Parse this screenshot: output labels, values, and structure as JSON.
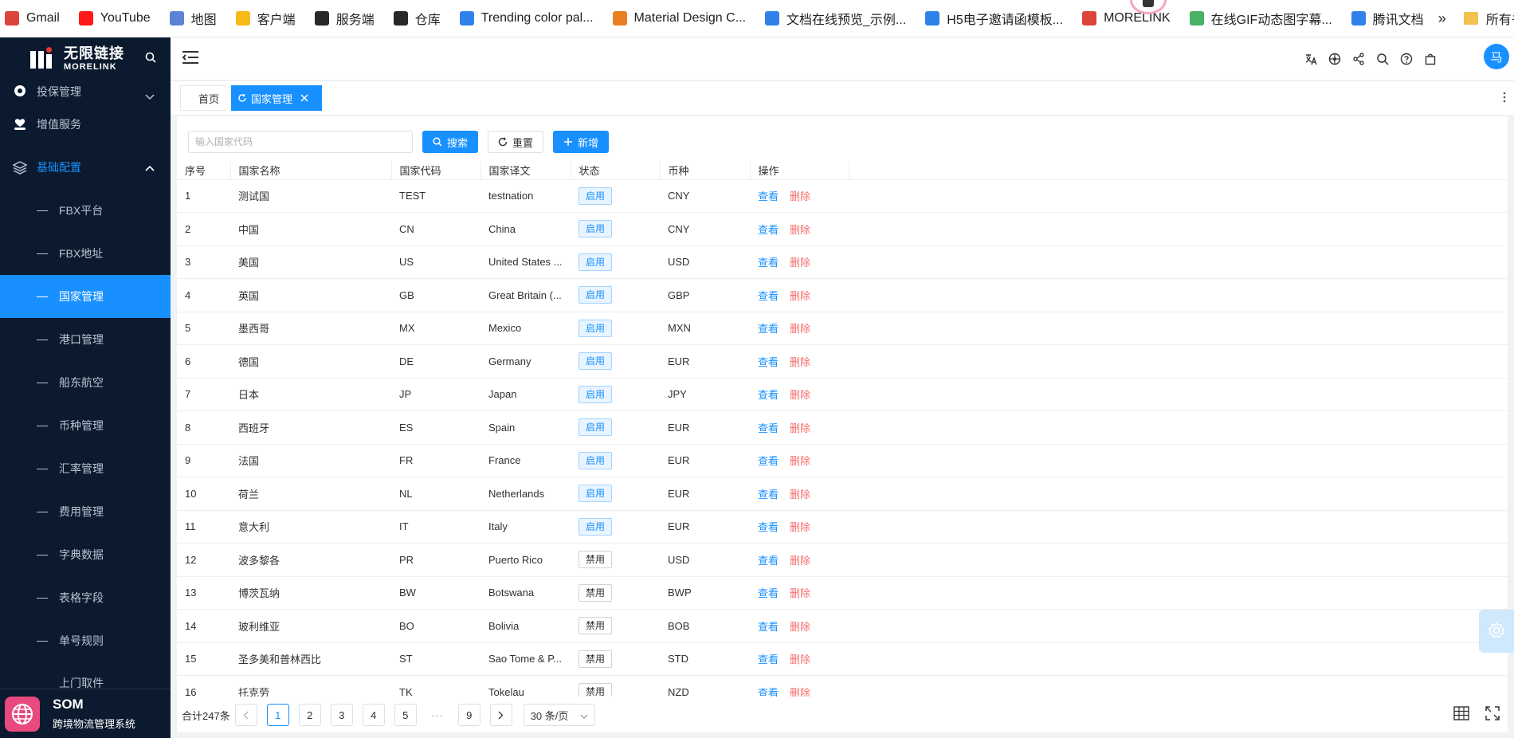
{
  "bookmarks": {
    "items": [
      {
        "label": "Gmail",
        "icon": "gmail-icon",
        "color": "#d93025"
      },
      {
        "label": "YouTube",
        "icon": "youtube-icon",
        "color": "#ff0000"
      },
      {
        "label": "地图",
        "icon": "map-icon",
        "color": "#4a76d1"
      },
      {
        "label": "客户端",
        "icon": "client-icon",
        "color": "#f4b400"
      },
      {
        "label": "服务端",
        "icon": "morelink-icon",
        "color": "#111111"
      },
      {
        "label": "仓库",
        "icon": "morelink-icon",
        "color": "#111111"
      },
      {
        "label": "Trending color pal...",
        "icon": "colorpal-icon",
        "color": "#1a73e8"
      },
      {
        "label": "Material Design C...",
        "icon": "material-icon",
        "color": "#e8710a"
      },
      {
        "label": "文档在线预览_示例...",
        "icon": "doc-icon",
        "color": "#1a73e8"
      },
      {
        "label": "H5电子邀请函模板...",
        "icon": "h5-icon",
        "color": "#1a73e8"
      },
      {
        "label": "MORELINK",
        "icon": "gmail-icon",
        "color": "#d93025"
      },
      {
        "label": "在线GIF动态图字幕...",
        "icon": "gif-icon",
        "color": "#34a853"
      },
      {
        "label": "腾讯文档",
        "icon": "tencent-doc-icon",
        "color": "#1a73e8"
      }
    ],
    "more": "»",
    "folder_label": "所有书签"
  },
  "sidebar": {
    "logo_cn": "无限链接",
    "logo_en": "MORELINK",
    "menus": [
      {
        "label": "投保管理",
        "icon": "shield-icon",
        "state": "collapsed"
      },
      {
        "label": "增值服务",
        "icon": "heart-hand-icon",
        "state": "none"
      },
      {
        "label": "基础配置",
        "icon": "layers-icon",
        "state": "open"
      }
    ],
    "subitems": [
      {
        "label": "FBX平台"
      },
      {
        "label": "FBX地址"
      },
      {
        "label": "国家管理",
        "active": true
      },
      {
        "label": "港口管理"
      },
      {
        "label": "船东航空"
      },
      {
        "label": "币种管理"
      },
      {
        "label": "汇率管理"
      },
      {
        "label": "费用管理"
      },
      {
        "label": "字典数据"
      },
      {
        "label": "表格字段"
      },
      {
        "label": "单号规则"
      },
      {
        "label": "上门取件"
      }
    ],
    "footer_title": "SOM",
    "footer_subtitle": "跨境物流管理系统"
  },
  "header": {
    "avatar_text": "马"
  },
  "tabs": {
    "home": "首页",
    "current": "国家管理"
  },
  "toolbar": {
    "search_placeholder": "输入国家代码",
    "search_label": "搜索",
    "reset_label": "重置",
    "add_label": "新增"
  },
  "table": {
    "headers": [
      "序号",
      "国家名称",
      "国家代码",
      "国家译文",
      "状态",
      "币种",
      "操作"
    ],
    "view_label": "查看",
    "delete_label": "删除",
    "rows": [
      {
        "no": "1",
        "name": "测试国",
        "code": "TEST",
        "en": "testnation",
        "status": "启用",
        "enabled": true,
        "currency": "CNY"
      },
      {
        "no": "2",
        "name": "中国",
        "code": "CN",
        "en": "China",
        "status": "启用",
        "enabled": true,
        "currency": "CNY"
      },
      {
        "no": "3",
        "name": "美国",
        "code": "US",
        "en": "United States ...",
        "status": "启用",
        "enabled": true,
        "currency": "USD"
      },
      {
        "no": "4",
        "name": "英国",
        "code": "GB",
        "en": "Great Britain (...",
        "status": "启用",
        "enabled": true,
        "currency": "GBP"
      },
      {
        "no": "5",
        "name": "墨西哥",
        "code": "MX",
        "en": "Mexico",
        "status": "启用",
        "enabled": true,
        "currency": "MXN"
      },
      {
        "no": "6",
        "name": "德国",
        "code": "DE",
        "en": "Germany",
        "status": "启用",
        "enabled": true,
        "currency": "EUR"
      },
      {
        "no": "7",
        "name": "日本",
        "code": "JP",
        "en": "Japan",
        "status": "启用",
        "enabled": true,
        "currency": "JPY"
      },
      {
        "no": "8",
        "name": "西班牙",
        "code": "ES",
        "en": "Spain",
        "status": "启用",
        "enabled": true,
        "currency": "EUR"
      },
      {
        "no": "9",
        "name": "法国",
        "code": "FR",
        "en": "France",
        "status": "启用",
        "enabled": true,
        "currency": "EUR"
      },
      {
        "no": "10",
        "name": "荷兰",
        "code": "NL",
        "en": "Netherlands",
        "status": "启用",
        "enabled": true,
        "currency": "EUR"
      },
      {
        "no": "11",
        "name": "意大利",
        "code": "IT",
        "en": "Italy",
        "status": "启用",
        "enabled": true,
        "currency": "EUR"
      },
      {
        "no": "12",
        "name": "波多黎各",
        "code": "PR",
        "en": "Puerto Rico",
        "status": "禁用",
        "enabled": false,
        "currency": "USD"
      },
      {
        "no": "13",
        "name": "博茨瓦纳",
        "code": "BW",
        "en": "Botswana",
        "status": "禁用",
        "enabled": false,
        "currency": "BWP"
      },
      {
        "no": "14",
        "name": "玻利维亚",
        "code": "BO",
        "en": "Bolivia",
        "status": "禁用",
        "enabled": false,
        "currency": "BOB"
      },
      {
        "no": "15",
        "name": "圣多美和普林西比",
        "code": "ST",
        "en": "Sao Tome & P...",
        "status": "禁用",
        "enabled": false,
        "currency": "STD"
      },
      {
        "no": "16",
        "name": "托克劳",
        "code": "TK",
        "en": "Tokelau",
        "status": "禁用",
        "enabled": false,
        "currency": "NZD"
      }
    ]
  },
  "pagination": {
    "total_text": "合计247条",
    "pages": [
      "1",
      "2",
      "3",
      "4",
      "5"
    ],
    "ellipsis": "···",
    "last_page": "9",
    "current_page": "1",
    "page_size": "30 条/页"
  },
  "colors": {
    "primary": "#1890ff",
    "sidebar_bg": "#0b1a2e",
    "danger": "#f56c6c",
    "brand_pink": "#e84a7f"
  }
}
